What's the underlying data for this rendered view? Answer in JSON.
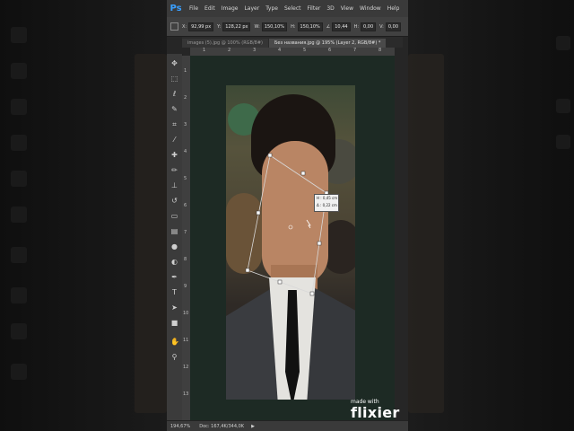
{
  "app": {
    "logo": "Ps"
  },
  "menubar": {
    "items": [
      "File",
      "Edit",
      "Image",
      "Layer",
      "Type",
      "Select",
      "Filter",
      "3D",
      "View",
      "Window",
      "Help"
    ]
  },
  "options": {
    "x_label": "X:",
    "x_value": "92,99 px",
    "y_label": "Y:",
    "y_value": "128,22 px",
    "w_label": "W:",
    "w_value": "150,10%",
    "h_label": "H:",
    "h_value": "150,10%",
    "rot_value": "10,44",
    "hs_label": "H:",
    "hs_value": "0,00",
    "vs_label": "V:",
    "vs_value": "0,00"
  },
  "tabs": [
    {
      "label": "images (5).jpg @ 100% (RGB/8#)",
      "active": false
    },
    {
      "label": "Без названия.jpg @ 195% (Layer 2, RGB/8#) *",
      "active": true
    }
  ],
  "ruler_top": [
    "1",
    "2",
    "3",
    "4",
    "5",
    "6",
    "7",
    "8"
  ],
  "ruler_left": [
    "1",
    "2",
    "3",
    "4",
    "5",
    "6",
    "7",
    "8",
    "9",
    "10",
    "11",
    "12",
    "13"
  ],
  "tooltip": {
    "line1": "H : 0,45 cm",
    "line2": "Δ : 0,22 cm"
  },
  "status": {
    "zoom": "194,67%",
    "doc": "Doc: 167,4K/344,0K"
  },
  "swatches": {
    "foreground": "#1fdc1f",
    "background": "#000000"
  },
  "watermark": {
    "small": "made with",
    "big": "flixier"
  },
  "tools": [
    "move-icon",
    "marquee-icon",
    "lasso-icon",
    "quick-select-icon",
    "crop-icon",
    "eyedropper-icon",
    "healing-icon",
    "brush-icon",
    "stamp-icon",
    "history-brush-icon",
    "eraser-icon",
    "gradient-icon",
    "blur-icon",
    "dodge-icon",
    "pen-icon",
    "type-icon",
    "path-select-icon",
    "shape-icon",
    "hand-icon",
    "zoom-icon"
  ]
}
